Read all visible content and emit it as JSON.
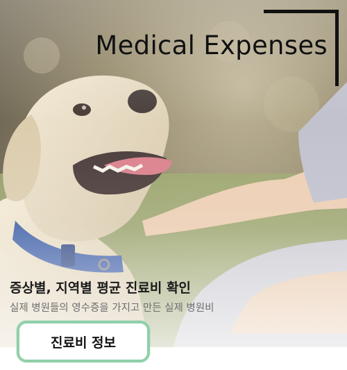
{
  "banner": {
    "title": "Medical Expenses",
    "headline": "증상별, 지역별 평균 진료비 확인",
    "subline": "실제 병원들의 영수증을 가지고 만든 실제 병원비",
    "cta_label": "진료비 정보"
  },
  "colors": {
    "title": "#111111",
    "cta_border": "#8fd0a9",
    "headline": "#1a1a1a",
    "subline": "#6e6e6e"
  },
  "icons": {
    "photo": "dog-with-blue-collar"
  }
}
